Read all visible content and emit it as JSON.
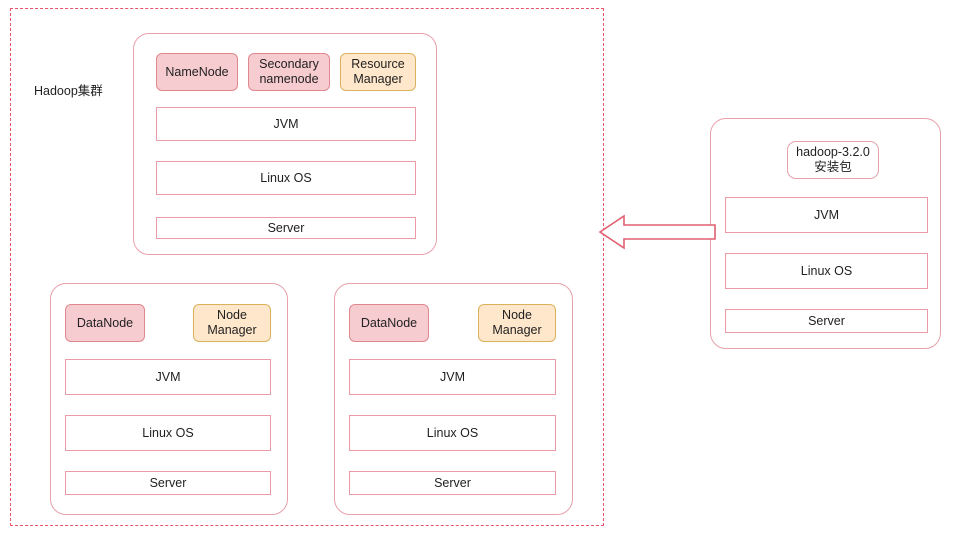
{
  "diagram": {
    "title": "Hadoop集群",
    "colors": {
      "dashed_boundary": "#e8536a",
      "host_border": "#e8a0ab",
      "chip_pink_fill": "#f7ccd0",
      "chip_pink_border": "#e0888f",
      "chip_yellow_fill": "#ffe7cb",
      "chip_yellow_border": "#dbb25c",
      "layer_border": "#ec9aa6",
      "arrow": "#e06070",
      "text": "#1f1f1f",
      "background": "#ffffff"
    },
    "cluster_label": "Hadoop集群",
    "master": {
      "name": "master-host",
      "services": [
        {
          "label": "NameNode",
          "style": "pink"
        },
        {
          "label": "Secondary\nnamenode",
          "style": "pink"
        },
        {
          "label": "Resource\nManager",
          "style": "yellow"
        }
      ],
      "layers": [
        "JVM",
        "Linux OS",
        "Server"
      ]
    },
    "workers": [
      {
        "name": "worker-host-1",
        "services": [
          {
            "label": "DataNode",
            "style": "pink"
          },
          {
            "label": "Node\nManager",
            "style": "yellow"
          }
        ],
        "layers": [
          "JVM",
          "Linux OS",
          "Server"
        ]
      },
      {
        "name": "worker-host-2",
        "services": [
          {
            "label": "DataNode",
            "style": "pink"
          },
          {
            "label": "Node\nManager",
            "style": "yellow"
          }
        ],
        "layers": [
          "JVM",
          "Linux OS",
          "Server"
        ]
      }
    ],
    "source_host": {
      "name": "install-source-host",
      "package_label": "hadoop-3.2.0\n安装包",
      "layers": [
        "JVM",
        "Linux OS",
        "Server"
      ]
    },
    "arrow": {
      "name": "install-distribution-arrow",
      "direction": "left",
      "label": ""
    }
  }
}
